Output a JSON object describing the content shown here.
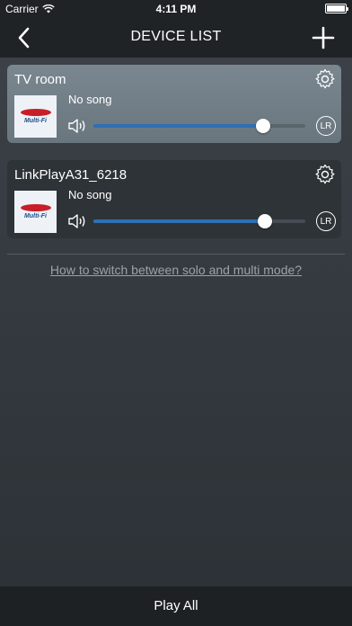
{
  "status_bar": {
    "carrier": "Carrier",
    "time": "4:11 PM"
  },
  "nav": {
    "title": "DEVICE LIST",
    "back_icon": "chevron-left",
    "add_icon": "plus"
  },
  "devices": [
    {
      "name": "TV room",
      "song": "No song",
      "album_logo_text": "Multi-Fi",
      "volume": 0.8,
      "channel": "LR",
      "selected": true
    },
    {
      "name": "LinkPlayA31_6218",
      "song": "No song",
      "album_logo_text": "Multi-Fi",
      "volume": 0.81,
      "channel": "LR",
      "selected": false
    }
  ],
  "help_link": "How to switch between solo and multi mode?",
  "footer": {
    "play_all": "Play All"
  },
  "colors": {
    "accent": "#2f6fb3",
    "selected_card": "#76838b",
    "card": "#2e3337",
    "bar": "#202326"
  }
}
